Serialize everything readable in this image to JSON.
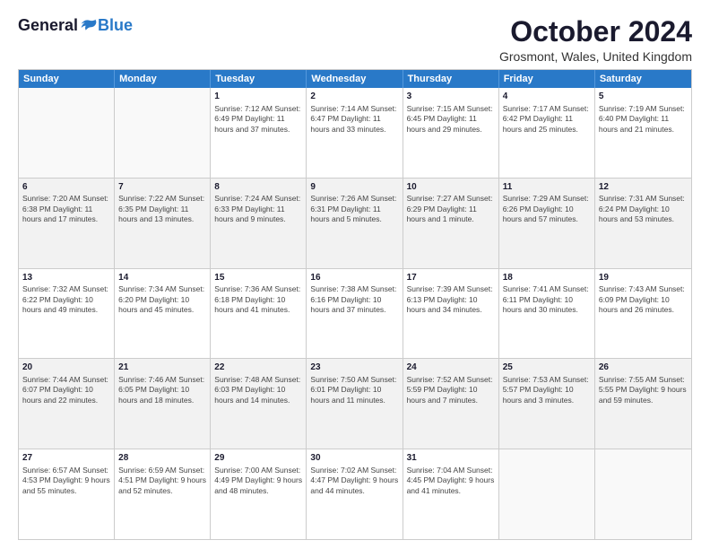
{
  "logo": {
    "general": "General",
    "blue": "Blue"
  },
  "title": "October 2024",
  "location": "Grosmont, Wales, United Kingdom",
  "headers": [
    "Sunday",
    "Monday",
    "Tuesday",
    "Wednesday",
    "Thursday",
    "Friday",
    "Saturday"
  ],
  "rows": [
    [
      {
        "day": "",
        "text": ""
      },
      {
        "day": "",
        "text": ""
      },
      {
        "day": "1",
        "text": "Sunrise: 7:12 AM\nSunset: 6:49 PM\nDaylight: 11 hours and 37 minutes."
      },
      {
        "day": "2",
        "text": "Sunrise: 7:14 AM\nSunset: 6:47 PM\nDaylight: 11 hours and 33 minutes."
      },
      {
        "day": "3",
        "text": "Sunrise: 7:15 AM\nSunset: 6:45 PM\nDaylight: 11 hours and 29 minutes."
      },
      {
        "day": "4",
        "text": "Sunrise: 7:17 AM\nSunset: 6:42 PM\nDaylight: 11 hours and 25 minutes."
      },
      {
        "day": "5",
        "text": "Sunrise: 7:19 AM\nSunset: 6:40 PM\nDaylight: 11 hours and 21 minutes."
      }
    ],
    [
      {
        "day": "6",
        "text": "Sunrise: 7:20 AM\nSunset: 6:38 PM\nDaylight: 11 hours and 17 minutes."
      },
      {
        "day": "7",
        "text": "Sunrise: 7:22 AM\nSunset: 6:35 PM\nDaylight: 11 hours and 13 minutes."
      },
      {
        "day": "8",
        "text": "Sunrise: 7:24 AM\nSunset: 6:33 PM\nDaylight: 11 hours and 9 minutes."
      },
      {
        "day": "9",
        "text": "Sunrise: 7:26 AM\nSunset: 6:31 PM\nDaylight: 11 hours and 5 minutes."
      },
      {
        "day": "10",
        "text": "Sunrise: 7:27 AM\nSunset: 6:29 PM\nDaylight: 11 hours and 1 minute."
      },
      {
        "day": "11",
        "text": "Sunrise: 7:29 AM\nSunset: 6:26 PM\nDaylight: 10 hours and 57 minutes."
      },
      {
        "day": "12",
        "text": "Sunrise: 7:31 AM\nSunset: 6:24 PM\nDaylight: 10 hours and 53 minutes."
      }
    ],
    [
      {
        "day": "13",
        "text": "Sunrise: 7:32 AM\nSunset: 6:22 PM\nDaylight: 10 hours and 49 minutes."
      },
      {
        "day": "14",
        "text": "Sunrise: 7:34 AM\nSunset: 6:20 PM\nDaylight: 10 hours and 45 minutes."
      },
      {
        "day": "15",
        "text": "Sunrise: 7:36 AM\nSunset: 6:18 PM\nDaylight: 10 hours and 41 minutes."
      },
      {
        "day": "16",
        "text": "Sunrise: 7:38 AM\nSunset: 6:16 PM\nDaylight: 10 hours and 37 minutes."
      },
      {
        "day": "17",
        "text": "Sunrise: 7:39 AM\nSunset: 6:13 PM\nDaylight: 10 hours and 34 minutes."
      },
      {
        "day": "18",
        "text": "Sunrise: 7:41 AM\nSunset: 6:11 PM\nDaylight: 10 hours and 30 minutes."
      },
      {
        "day": "19",
        "text": "Sunrise: 7:43 AM\nSunset: 6:09 PM\nDaylight: 10 hours and 26 minutes."
      }
    ],
    [
      {
        "day": "20",
        "text": "Sunrise: 7:44 AM\nSunset: 6:07 PM\nDaylight: 10 hours and 22 minutes."
      },
      {
        "day": "21",
        "text": "Sunrise: 7:46 AM\nSunset: 6:05 PM\nDaylight: 10 hours and 18 minutes."
      },
      {
        "day": "22",
        "text": "Sunrise: 7:48 AM\nSunset: 6:03 PM\nDaylight: 10 hours and 14 minutes."
      },
      {
        "day": "23",
        "text": "Sunrise: 7:50 AM\nSunset: 6:01 PM\nDaylight: 10 hours and 11 minutes."
      },
      {
        "day": "24",
        "text": "Sunrise: 7:52 AM\nSunset: 5:59 PM\nDaylight: 10 hours and 7 minutes."
      },
      {
        "day": "25",
        "text": "Sunrise: 7:53 AM\nSunset: 5:57 PM\nDaylight: 10 hours and 3 minutes."
      },
      {
        "day": "26",
        "text": "Sunrise: 7:55 AM\nSunset: 5:55 PM\nDaylight: 9 hours and 59 minutes."
      }
    ],
    [
      {
        "day": "27",
        "text": "Sunrise: 6:57 AM\nSunset: 4:53 PM\nDaylight: 9 hours and 55 minutes."
      },
      {
        "day": "28",
        "text": "Sunrise: 6:59 AM\nSunset: 4:51 PM\nDaylight: 9 hours and 52 minutes."
      },
      {
        "day": "29",
        "text": "Sunrise: 7:00 AM\nSunset: 4:49 PM\nDaylight: 9 hours and 48 minutes."
      },
      {
        "day": "30",
        "text": "Sunrise: 7:02 AM\nSunset: 4:47 PM\nDaylight: 9 hours and 44 minutes."
      },
      {
        "day": "31",
        "text": "Sunrise: 7:04 AM\nSunset: 4:45 PM\nDaylight: 9 hours and 41 minutes."
      },
      {
        "day": "",
        "text": ""
      },
      {
        "day": "",
        "text": ""
      }
    ]
  ],
  "alt_rows": [
    1,
    3
  ]
}
